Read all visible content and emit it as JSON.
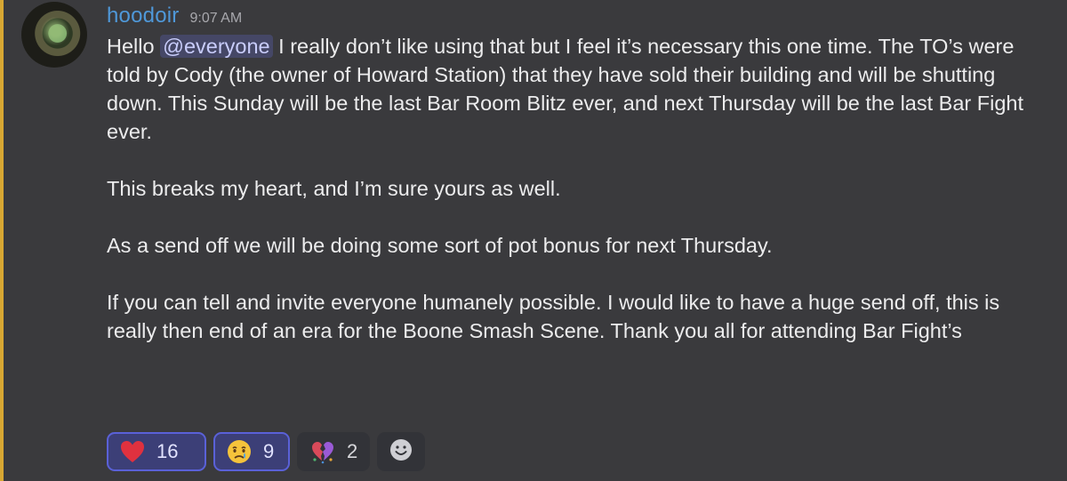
{
  "message": {
    "username": "hoodoir",
    "timestamp": "9:07 AM",
    "mention": "@everyone",
    "paragraphs": {
      "p1_before": "Hello ",
      "p1_after": " I really don’t like using that but I feel it’s necessary this one time. The TO’s were told by Cody (the owner of Howard Station) that they have sold their building and will be shutting down. This Sunday will be the last Bar Room Blitz ever, and next Thursday will be the last Bar Fight ever.",
      "p2": "This breaks my heart, and I’m sure yours as well.",
      "p3": "As a send off we will be doing some sort of pot bonus for next Thursday.",
      "p4": "If you can tell and invite everyone humanely possible. I would like to have a huge send off, this is really then end of an era for the Boone Smash Scene. Thank you all for attending Bar Fight’s"
    }
  },
  "reactions": [
    {
      "icon": "heart-emoji-icon",
      "count": "16",
      "active": true
    },
    {
      "icon": "crying-face-emoji-icon",
      "count": "9",
      "active": true
    },
    {
      "icon": "broken-heart-pieces-emoji-icon",
      "count": "2",
      "active": false
    }
  ],
  "add_reaction_icon": "smiley-icon",
  "colors": {
    "background": "#3a3a3d",
    "accent_bar": "#d7a733",
    "username": "#4f98d9",
    "mention_bg": "#454766",
    "reaction_active_bg": "#3c3f77",
    "reaction_active_border": "#5a61d8"
  }
}
